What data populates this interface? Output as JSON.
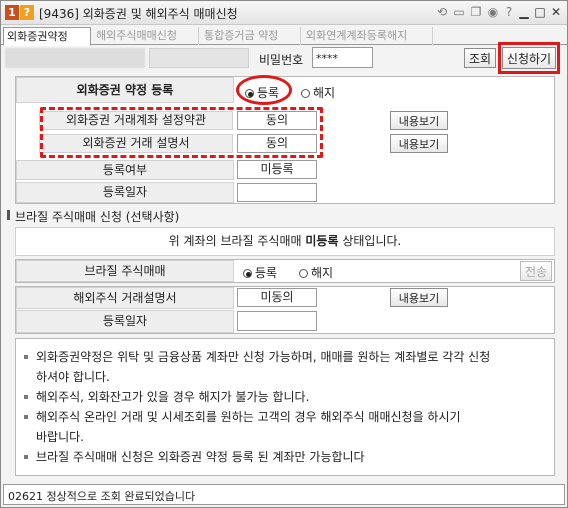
{
  "window": {
    "screen_no": "1",
    "help": "?",
    "title": "[9436] 외화증권 및 해외주식 매매신청"
  },
  "tabs": [
    {
      "label": "외화증권약정",
      "active": true
    },
    {
      "label": "해외주식매매신청",
      "active": false
    },
    {
      "label": "통합증거금 약정",
      "active": false
    },
    {
      "label": "외화연계계좌등록해지",
      "active": false
    }
  ],
  "account": {
    "password_label": "비밀번호",
    "password_value": "****",
    "query_button": "조회",
    "apply_button": "신청하기"
  },
  "agreement": {
    "header": "외화증권 약정 등록",
    "register_label": "등록",
    "cancel_label": "해지",
    "selected": "등록",
    "rows": [
      {
        "label": "외화증권 거래계좌 설정약관",
        "value": "동의",
        "button": "내용보기"
      },
      {
        "label": "외화증권 거래 설명서",
        "value": "동의",
        "button": "내용보기"
      }
    ],
    "status_label": "등록여부",
    "status_value": "미등록",
    "date_label": "등록일자",
    "date_value": ""
  },
  "brazil": {
    "section_title": "브라질 주식매매 신청 (선택사항)",
    "msg_prefix": "위 계좌의 브라질 주식매매",
    "msg_status": "미등록",
    "msg_suffix": "상태입니다.",
    "trade_label": "브라질 주식매매",
    "register_label": "등록",
    "cancel_label": "해지",
    "send_button": "전송",
    "manual_label": "해외주식 거래설명서",
    "manual_value": "미동의",
    "manual_button": "내용보기",
    "date_label": "등록일자",
    "date_value": ""
  },
  "notes": [
    "외화증권약정은 위탁 및 금융상품 계좌만 신청 가능하며, 매매를 원하는 계좌별로 각각 신청",
    "하셔야 합니다.",
    "해외주식, 외화잔고가 있을 경우 해지가 불가능 합니다.",
    "해외주식 온라인 거래 및 시세조회를 원하는 고객의 경우 해외주식 매매신청을 하시기",
    "바랍니다.",
    "브라질 주식매매 신청은 외화증권 약정 등록 된 계좌만 가능합니다"
  ],
  "status_bar": "02621 정상적으로 조회 완료되었습니다",
  "colors": {
    "highlight": "#e01818"
  }
}
